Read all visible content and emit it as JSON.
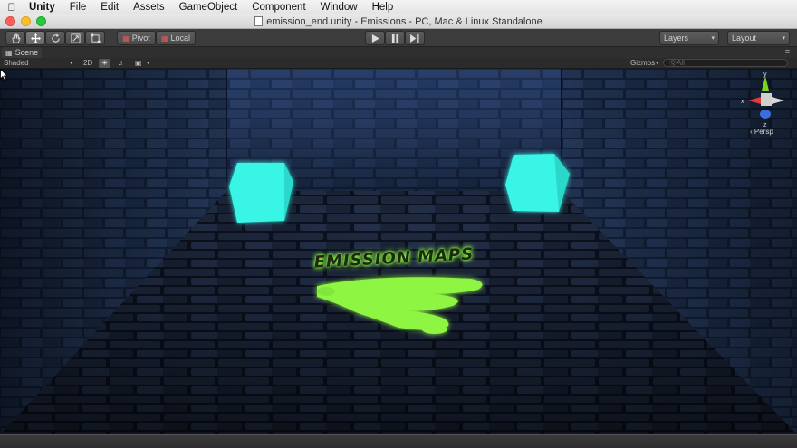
{
  "menubar": {
    "apple_icon": "apple-icon",
    "items": [
      "Unity",
      "File",
      "Edit",
      "Assets",
      "GameObject",
      "Component",
      "Window",
      "Help"
    ]
  },
  "window": {
    "title": "emission_end.unity - Emissions - PC, Mac & Linux Standalone"
  },
  "toolbar": {
    "transform_tools": [
      "hand-icon",
      "move-icon",
      "rotate-icon",
      "scale-icon",
      "rect-icon"
    ],
    "active_tool": "move-icon",
    "pivot_label": "Pivot",
    "local_label": "Local",
    "play_icons": [
      "play-icon",
      "pause-icon",
      "step-icon"
    ],
    "layers_label": "Layers",
    "layout_label": "Layout"
  },
  "scene_tab": {
    "label": "Scene"
  },
  "scene_bar": {
    "draw_mode": "Shaded",
    "mode_2d": "2D",
    "gizmos_label": "Gizmos",
    "search_placeholder": "ⓆAll"
  },
  "viewport": {
    "sign_text": "EMISSION MAPS",
    "gizmo": {
      "x_label": "x",
      "y_label": "y",
      "z_label": "z",
      "projection": "‹ Persp"
    },
    "colors": {
      "cube": "#37f5e6",
      "sign_green": "#8ef542",
      "bricks": "#1e2d4c"
    }
  }
}
